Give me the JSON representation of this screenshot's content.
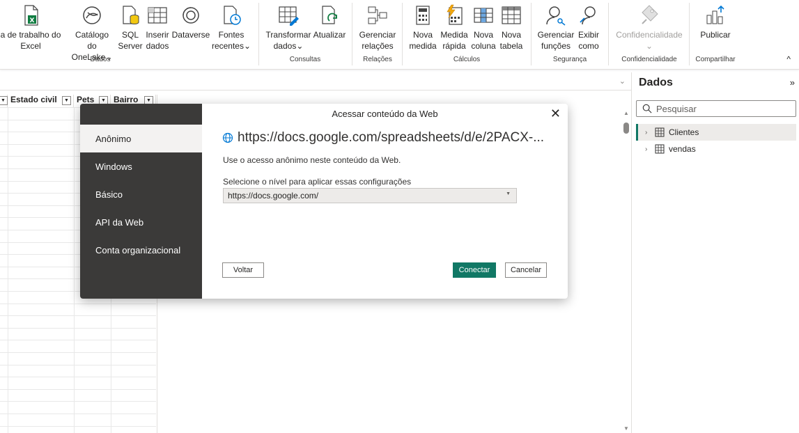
{
  "ribbon": {
    "items": [
      {
        "label": "a de trabalho do\nExcel",
        "icon": "excel-workbook-icon"
      },
      {
        "label": "Catálogo\ndo OneLake⌄",
        "icon": "onelake-catalog-icon"
      },
      {
        "label": "SQL\nServer",
        "icon": "sql-server-icon"
      },
      {
        "label": "Inserir\ndados",
        "icon": "enter-data-icon"
      },
      {
        "label": "Dataverse",
        "icon": "dataverse-icon"
      },
      {
        "label": "Fontes\nrecentes⌄",
        "icon": "recent-sources-icon"
      },
      {
        "label": "Transformar\ndados⌄",
        "icon": "transform-data-icon"
      },
      {
        "label": "Atualizar",
        "icon": "refresh-icon"
      },
      {
        "label": "Gerenciar\nrelações",
        "icon": "manage-relationships-icon"
      },
      {
        "label": "Nova\nmedida",
        "icon": "new-measure-icon"
      },
      {
        "label": "Medida\nrápida",
        "icon": "quick-measure-icon"
      },
      {
        "label": "Nova\ncoluna",
        "icon": "new-column-icon"
      },
      {
        "label": "Nova\ntabela",
        "icon": "new-table-icon"
      },
      {
        "label": "Gerenciar\nfunções",
        "icon": "manage-roles-icon"
      },
      {
        "label": "Exibir\ncomo",
        "icon": "view-as-icon"
      },
      {
        "label": "Confidencialidade\n⌄",
        "icon": "sensitivity-icon"
      },
      {
        "label": "Publicar",
        "icon": "publish-icon"
      }
    ],
    "groups": [
      "Dados",
      "Consultas",
      "Relações",
      "Cálculos",
      "Segurança",
      "Confidencialidade",
      "Compartilhar"
    ],
    "collapse": "^"
  },
  "grid": {
    "columns": [
      "",
      "Estado civil",
      "Pets",
      "Bairro"
    ]
  },
  "pane": {
    "title": "Dados",
    "collapse": "»",
    "search_placeholder": "Pesquisar",
    "tables": [
      {
        "name": "Clientes",
        "selected": true
      },
      {
        "name": "vendas",
        "selected": false
      }
    ]
  },
  "dialog": {
    "title": "Acessar conteúdo da Web",
    "close": "✕",
    "nav": [
      "Anônimo",
      "Windows",
      "Básico",
      "API da Web",
      "Conta organizacional"
    ],
    "active_nav": "Anônimo",
    "url": "https://docs.google.com/spreadsheets/d/e/2PACX-...",
    "description": "Use o acesso anônimo neste conteúdo da Web.",
    "level_label": "Selecione o nível para aplicar essas configurações",
    "level_value": "https://docs.google.com/",
    "buttons": {
      "back": "Voltar",
      "connect": "Conectar",
      "cancel": "Cancelar"
    },
    "accent": "#117865"
  }
}
